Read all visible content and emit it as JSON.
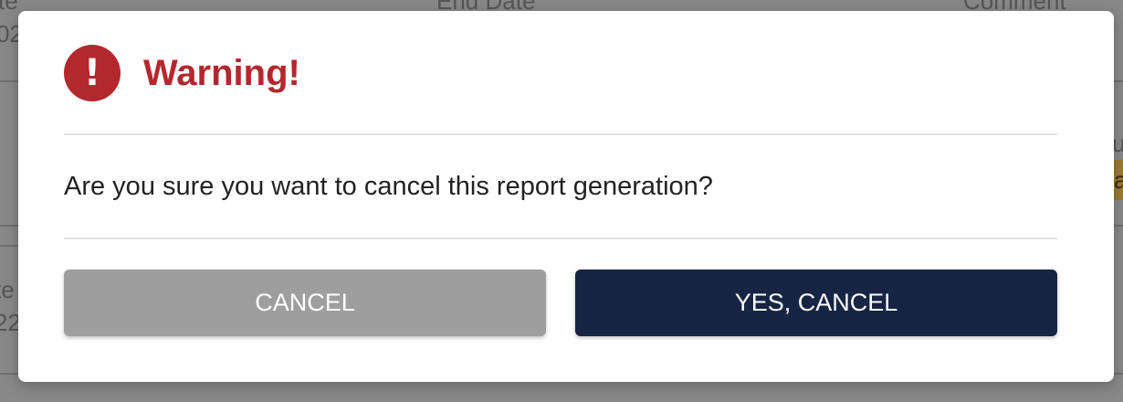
{
  "background": {
    "fragments": [
      "te",
      "End Date",
      "Comment",
      "02",
      "u",
      "ac",
      "te",
      "22"
    ]
  },
  "dialog": {
    "icon": "exclamation-icon",
    "title": "Warning!",
    "message": "Are you sure you want to cancel this report generation?",
    "cancel_label": "CANCEL",
    "confirm_label": "YES, CANCEL"
  },
  "colors": {
    "title": "#b3282d",
    "icon_bg": "#b3282d",
    "cancel_button": "#9e9e9e",
    "confirm_button": "#172545",
    "overlay": "#888888"
  }
}
